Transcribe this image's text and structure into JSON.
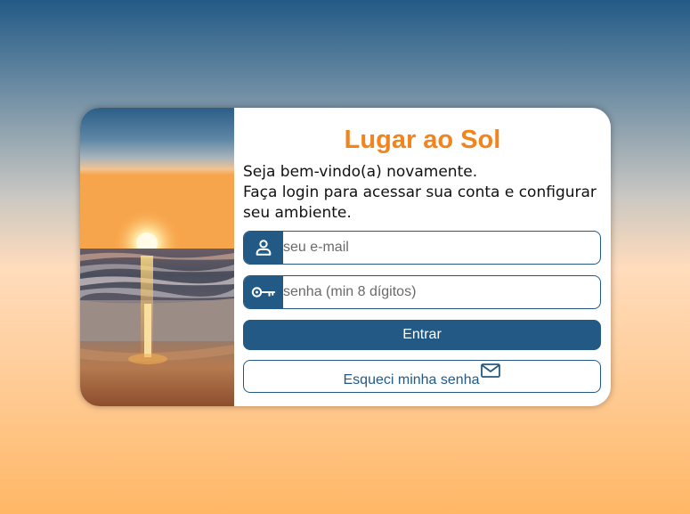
{
  "app": {
    "title": "Lugar ao Sol",
    "accent_color": "#f2841e",
    "brand_color": "#235a85"
  },
  "photo": {
    "description_icon": "beach-sunset-image"
  },
  "welcome": {
    "line1": "Seja bem-vindo(a) novamente.",
    "line2": "Faça login para acessar sua conta e configurar seu ambiente."
  },
  "form": {
    "email": {
      "icon": "user-icon",
      "placeholder": "seu e-mail",
      "value": ""
    },
    "password": {
      "icon": "key-icon",
      "placeholder": "senha (min 8 dígitos)",
      "value": ""
    },
    "submit_label": "Entrar",
    "forgot": {
      "label": "Esqueci minha senha",
      "icon": "mail-icon"
    }
  }
}
